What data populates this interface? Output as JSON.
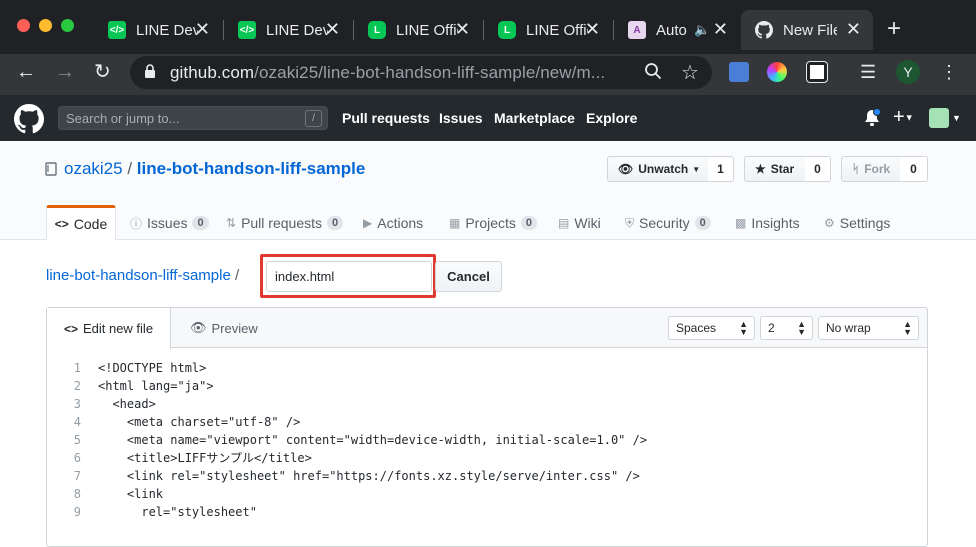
{
  "browser": {
    "tabs": [
      {
        "title": "LINE Developers",
        "favicon": "line-dev",
        "close": "✕"
      },
      {
        "title": "LINE Developers",
        "favicon": "line-dev",
        "close": "✕"
      },
      {
        "title": "LINE Official Account",
        "favicon": "line-oa",
        "close": "✕"
      },
      {
        "title": "LINE Official Account",
        "favicon": "line-oa",
        "close": "✕"
      },
      {
        "title": "Auto",
        "favicon": "auto",
        "close": "✕"
      },
      {
        "title": "New File",
        "favicon": "github",
        "close": "✕"
      }
    ],
    "new_tab": "+",
    "url_host": "github.com",
    "url_path": "/ozaki25/line-bot-handson-liff-sample/new/m...",
    "profile_initial": "Y"
  },
  "github": {
    "search_placeholder": "Search or jump to...",
    "search_shortcut": "/",
    "nav": [
      "Pull requests",
      "Issues",
      "Marketplace",
      "Explore"
    ],
    "owner": "ozaki25",
    "repo": "line-bot-handson-liff-sample",
    "watch_label": "Unwatch",
    "watch_count": "1",
    "star_label": "Star",
    "star_count": "0",
    "fork_label": "Fork",
    "fork_count": "0",
    "repo_tabs": {
      "code": "Code",
      "issues": "Issues",
      "issues_count": "0",
      "pulls": "Pull requests",
      "pulls_count": "0",
      "actions": "Actions",
      "projects": "Projects",
      "projects_count": "0",
      "wiki": "Wiki",
      "security": "Security",
      "security_count": "0",
      "insights": "Insights",
      "settings": "Settings"
    }
  },
  "editor": {
    "breadcrumb_repo": "line-bot-handson-liff-sample",
    "breadcrumb_sep": "/",
    "filename": "index.html",
    "cancel_label": "Cancel",
    "tab_edit": "Edit new file",
    "tab_preview": "Preview",
    "indent_mode": "Spaces",
    "indent_size": "2",
    "wrap_mode": "No wrap",
    "lines": [
      {
        "n": "1",
        "code": "<!DOCTYPE html>"
      },
      {
        "n": "2",
        "code": "<html lang=\"ja\">"
      },
      {
        "n": "3",
        "code": "  <head>"
      },
      {
        "n": "4",
        "code": "    <meta charset=\"utf-8\" />"
      },
      {
        "n": "5",
        "code": "    <meta name=\"viewport\" content=\"width=device-width, initial-scale=1.0\" />"
      },
      {
        "n": "6",
        "code": "    <title>LIFFサンプル</title>"
      },
      {
        "n": "7",
        "code": "    <link rel=\"stylesheet\" href=\"https://fonts.xz.style/serve/inter.css\" />"
      },
      {
        "n": "8",
        "code": "    <link"
      },
      {
        "n": "9",
        "code": "      rel=\"stylesheet\""
      }
    ]
  },
  "colors": {
    "highlight": "#e03a2f",
    "link": "#0366d6",
    "tab_underline": "#e36209",
    "header_bg": "#24292e"
  }
}
